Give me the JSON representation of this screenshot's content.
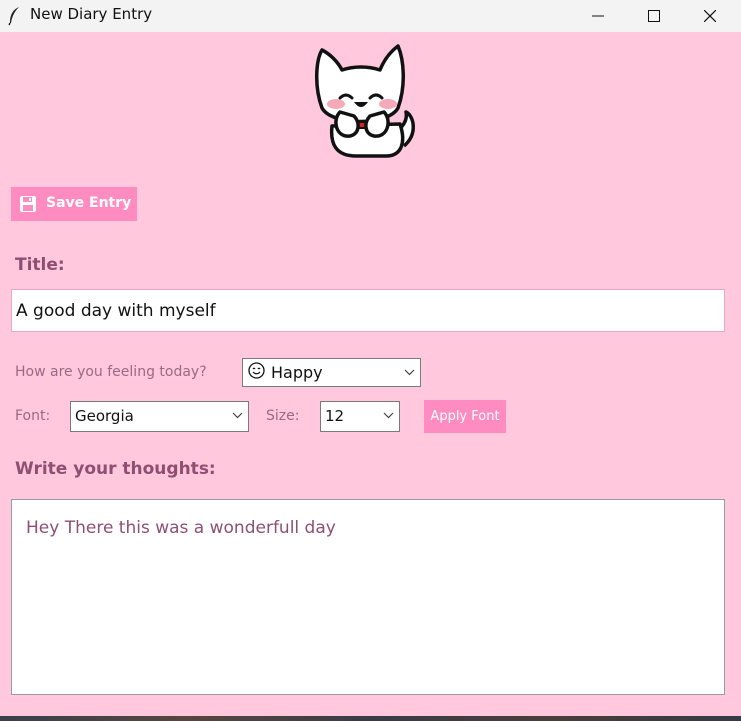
{
  "window": {
    "title": "New Diary Entry",
    "icon": "feather-icon",
    "controls": [
      "minimize-icon",
      "maximize-icon",
      "close-icon"
    ]
  },
  "mascot": {
    "icon": "cute-cat-mascot"
  },
  "toolbar": {
    "save_label": "Save Entry",
    "save_icon": "floppy-disk-icon"
  },
  "title_section": {
    "label": "Title:",
    "value": "A good day with myself"
  },
  "mood": {
    "label": "How are you feeling today?",
    "selected": "Happy",
    "selected_icon": "smiley-face-icon"
  },
  "font": {
    "label": "Font:",
    "selected": "Georgia",
    "size_label": "Size:",
    "size_selected": "12",
    "apply_label": "Apply Font"
  },
  "thoughts": {
    "label": "Write your thoughts:",
    "value": "Hey There this was a wonderfull day"
  },
  "colors": {
    "background": "#ffc8dd",
    "accent": "#ff8cc0",
    "heading": "#8e4f72",
    "muted_label": "#9a6a85"
  }
}
